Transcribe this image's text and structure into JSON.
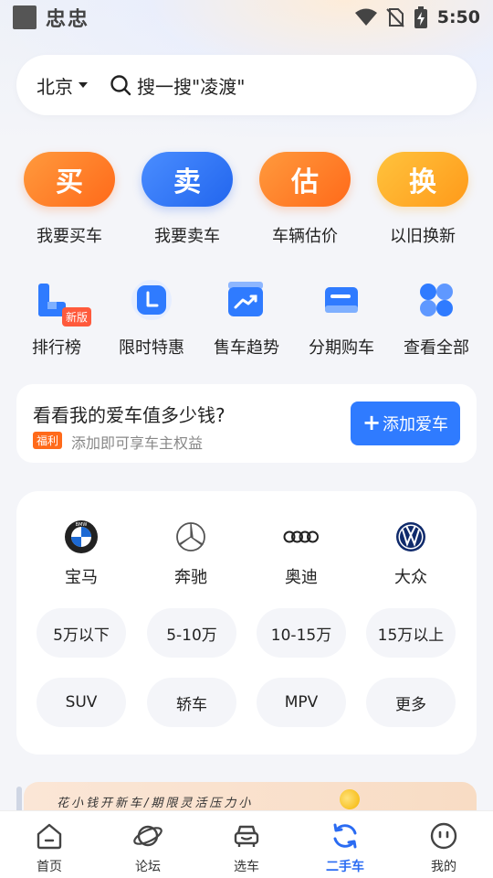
{
  "status_bar": {
    "app_label": "忠忠",
    "time": "5:50"
  },
  "search": {
    "city": "北京",
    "placeholder": "搜一搜\"凌渡\""
  },
  "primary_actions": [
    {
      "glyph": "买",
      "label": "我要买车",
      "color": "orange"
    },
    {
      "glyph": "卖",
      "label": "我要卖车",
      "color": "blue"
    },
    {
      "glyph": "估",
      "label": "车辆估价",
      "color": "orange"
    },
    {
      "glyph": "换",
      "label": "以旧换新",
      "color": "amber"
    }
  ],
  "secondary_actions": [
    {
      "label": "排行榜",
      "icon": "ranking-icon",
      "badge": "新版"
    },
    {
      "label": "限时特惠",
      "icon": "timer-icon"
    },
    {
      "label": "售车趋势",
      "icon": "trend-chart-icon"
    },
    {
      "label": "分期购车",
      "icon": "card-icon"
    },
    {
      "label": "查看全部",
      "icon": "grid-icon"
    }
  ],
  "value_card": {
    "title": "看看我的爱车值多少钱?",
    "tag": "福利",
    "subtitle": "添加即可享车主权益",
    "button": "添加爱车",
    "button_icon": "+"
  },
  "brands": [
    {
      "name": "宝马",
      "icon": "bmw-logo-icon",
      "logo_text": "BMW"
    },
    {
      "name": "奔驰",
      "icon": "mercedes-logo-icon"
    },
    {
      "name": "奥迪",
      "icon": "audi-logo-icon"
    },
    {
      "name": "大众",
      "icon": "volkswagen-logo-icon"
    }
  ],
  "price_filters": [
    "5万以下",
    "5-10万",
    "10-15万",
    "15万以上"
  ],
  "type_filters": [
    "SUV",
    "轿车",
    "MPV",
    "更多"
  ],
  "banner": {
    "text": "花小钱开新车/期限灵活压力小"
  },
  "bottom_nav": [
    {
      "label": "首页",
      "icon": "home-icon",
      "active": false
    },
    {
      "label": "论坛",
      "icon": "planet-icon",
      "active": false
    },
    {
      "label": "选车",
      "icon": "car-front-icon",
      "active": false
    },
    {
      "label": "二手车",
      "icon": "refresh-icon",
      "active": true
    },
    {
      "label": "我的",
      "icon": "face-icon",
      "active": false
    }
  ],
  "colors": {
    "accent_blue": "#2a6bf2",
    "orange": "#ff6a1a",
    "background": "#f4f5f9"
  }
}
